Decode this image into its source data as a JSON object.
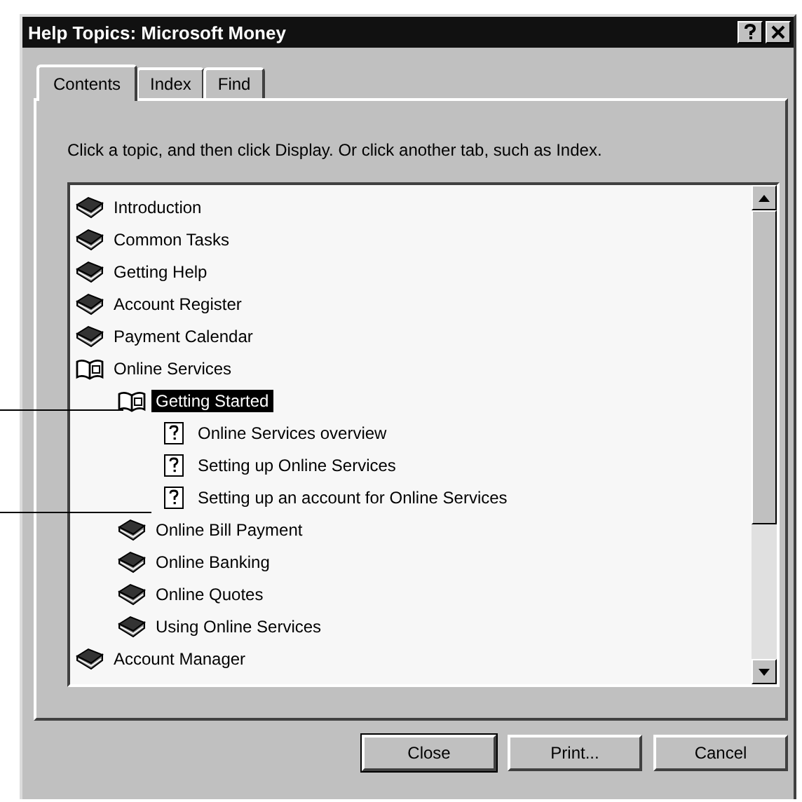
{
  "window": {
    "title": "Help Topics: Microsoft Money"
  },
  "tabs": [
    {
      "label": "Contents",
      "selected": true
    },
    {
      "label": "Index",
      "selected": false
    },
    {
      "label": "Find",
      "selected": false
    }
  ],
  "instruction": "Click a topic, and then click Display. Or click another tab, such as Index.",
  "tree": [
    {
      "kind": "book",
      "label": "Introduction",
      "expanded": false,
      "selected": false
    },
    {
      "kind": "book",
      "label": "Common Tasks",
      "expanded": false,
      "selected": false
    },
    {
      "kind": "book",
      "label": "Getting Help",
      "expanded": false,
      "selected": false
    },
    {
      "kind": "book",
      "label": "Account Register",
      "expanded": false,
      "selected": false
    },
    {
      "kind": "book",
      "label": "Payment Calendar",
      "expanded": false,
      "selected": false
    },
    {
      "kind": "book",
      "label": "Online Services",
      "expanded": true,
      "selected": false,
      "children": [
        {
          "kind": "book",
          "label": "Getting Started",
          "expanded": true,
          "selected": true,
          "children": [
            {
              "kind": "page",
              "label": "Online Services overview",
              "selected": false
            },
            {
              "kind": "page",
              "label": "Setting up Online Services",
              "selected": false
            },
            {
              "kind": "page",
              "label": "Setting up an account for Online Services",
              "selected": false
            }
          ]
        },
        {
          "kind": "book",
          "label": "Online Bill Payment",
          "expanded": false,
          "selected": false
        },
        {
          "kind": "book",
          "label": "Online Banking",
          "expanded": false,
          "selected": false
        },
        {
          "kind": "book",
          "label": "Online Quotes",
          "expanded": false,
          "selected": false
        },
        {
          "kind": "book",
          "label": "Using Online Services",
          "expanded": false,
          "selected": false
        }
      ]
    },
    {
      "kind": "book",
      "label": "Account Manager",
      "expanded": false,
      "selected": false
    }
  ],
  "buttons": [
    {
      "label": "Close",
      "default": true
    },
    {
      "label": "Print...",
      "default": false
    },
    {
      "label": "Cancel",
      "default": false
    }
  ]
}
